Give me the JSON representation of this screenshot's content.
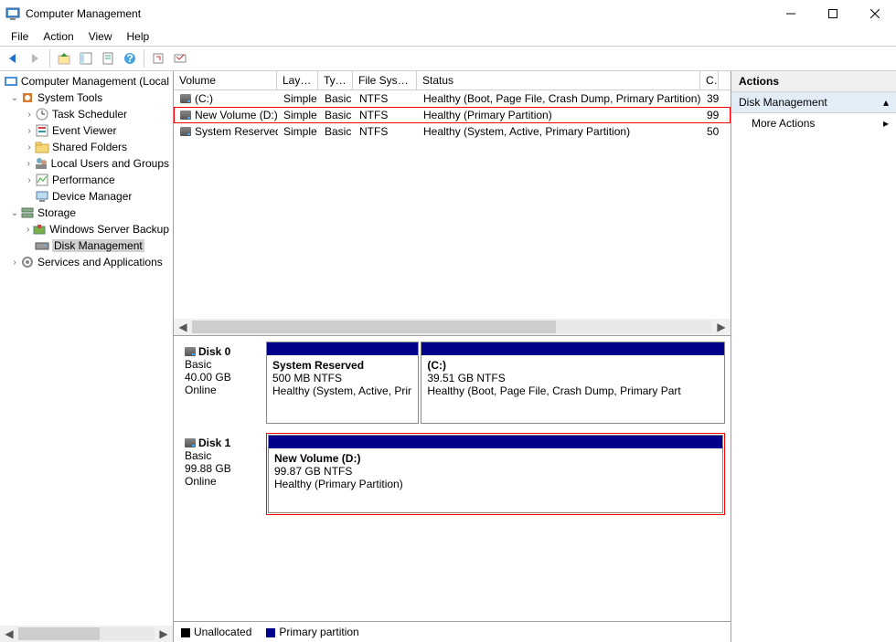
{
  "window": {
    "title": "Computer Management"
  },
  "menu": [
    "File",
    "Action",
    "View",
    "Help"
  ],
  "tree": {
    "root": "Computer Management (Local",
    "system_tools": "System Tools",
    "task_scheduler": "Task Scheduler",
    "event_viewer": "Event Viewer",
    "shared_folders": "Shared Folders",
    "local_users": "Local Users and Groups",
    "performance": "Performance",
    "device_manager": "Device Manager",
    "storage": "Storage",
    "windows_backup": "Windows Server Backup",
    "disk_management": "Disk Management",
    "services_apps": "Services and Applications"
  },
  "vol_headers": {
    "volume": "Volume",
    "layout": "Layout",
    "type": "Type",
    "fs": "File System",
    "status": "Status",
    "cap": "C"
  },
  "volumes": [
    {
      "name": "(C:)",
      "layout": "Simple",
      "type": "Basic",
      "fs": "NTFS",
      "status": "Healthy (Boot, Page File, Crash Dump, Primary Partition)",
      "cap": "39",
      "hl": false
    },
    {
      "name": "New Volume (D:)",
      "layout": "Simple",
      "type": "Basic",
      "fs": "NTFS",
      "status": "Healthy (Primary Partition)",
      "cap": "99",
      "hl": true
    },
    {
      "name": "System Reserved",
      "layout": "Simple",
      "type": "Basic",
      "fs": "NTFS",
      "status": "Healthy (System, Active, Primary Partition)",
      "cap": "50",
      "hl": false
    }
  ],
  "disks": [
    {
      "name": "Disk 0",
      "type": "Basic",
      "size": "40.00 GB",
      "state": "Online",
      "hl": false,
      "parts": [
        {
          "name": "System Reserved",
          "size": "500 MB NTFS",
          "status": "Healthy (System, Active, Prir",
          "flex": 1
        },
        {
          "name": "(C:)",
          "size": "39.51 GB NTFS",
          "status": "Healthy (Boot, Page File, Crash Dump, Primary Part",
          "flex": 2
        }
      ]
    },
    {
      "name": "Disk 1",
      "type": "Basic",
      "size": "99.88 GB",
      "state": "Online",
      "hl": true,
      "parts": [
        {
          "name": "New Volume  (D:)",
          "size": "99.87 GB NTFS",
          "status": "Healthy (Primary Partition)",
          "flex": 1
        }
      ]
    }
  ],
  "legend": {
    "unallocated": "Unallocated",
    "primary": "Primary partition"
  },
  "actions": {
    "title": "Actions",
    "section": "Disk Management",
    "more": "More Actions"
  }
}
